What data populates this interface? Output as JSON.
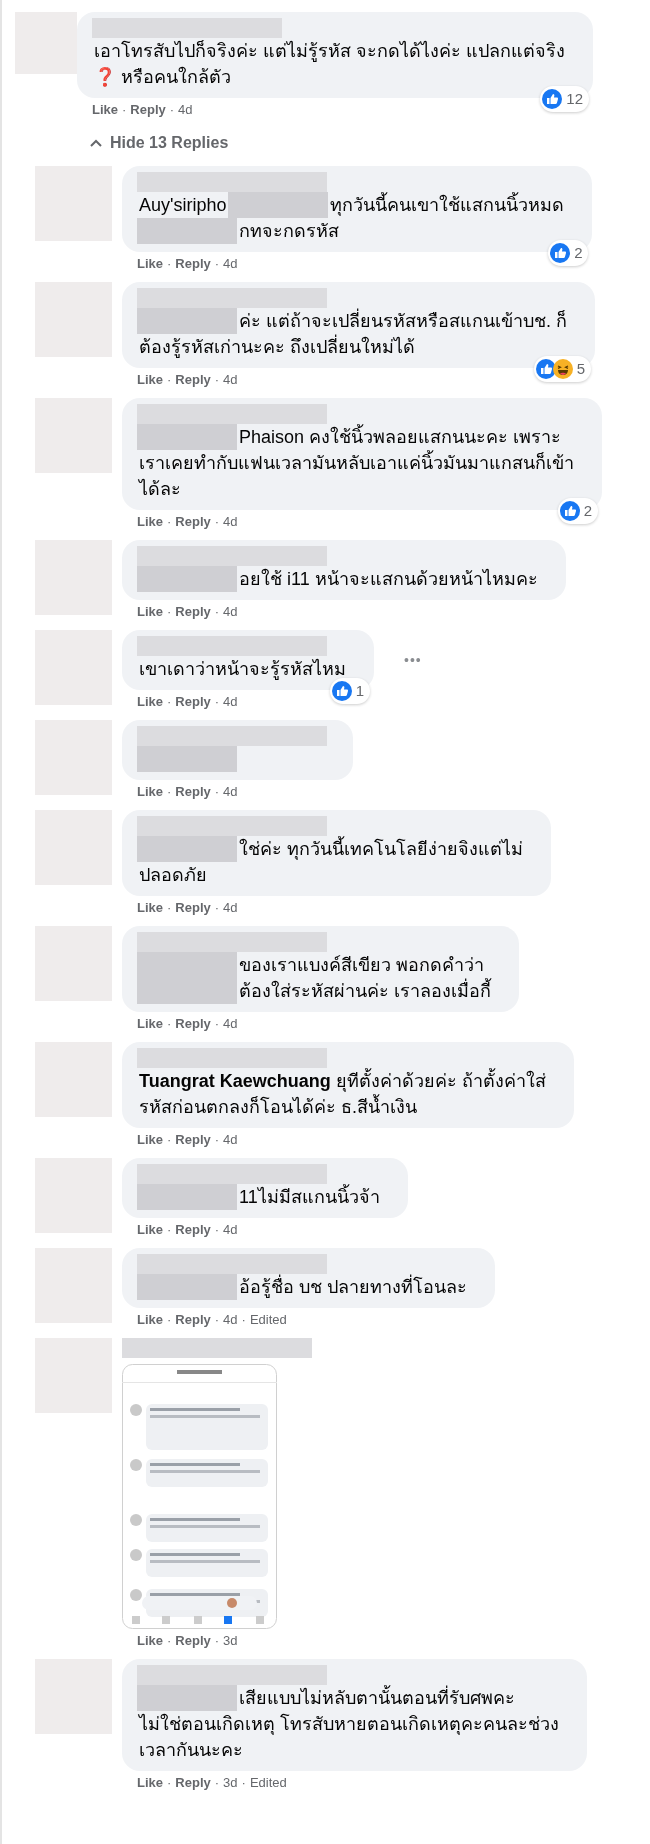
{
  "separator": "·",
  "comments": [
    {
      "kind": "comment",
      "lines": [
        [
          {
            "kind": "mask"
          }
        ],
        [
          {
            "kind": "text",
            "text": "เอาโทรสับไปก็จริงค่ะ แต่ไม่รู้รหัส จะกดได้ไงค่ะ แปลกแต่จริง"
          }
        ],
        [
          {
            "kind": "text",
            "text": "❓ หรือคนใกล้ตัว"
          }
        ]
      ],
      "reactions": {
        "icons": [
          {
            "kind": "like"
          }
        ],
        "count": "12"
      },
      "meta": [
        {
          "kind": "link",
          "text": "Like"
        },
        {
          "kind": "link",
          "text": "Reply"
        },
        {
          "kind": "time",
          "text": "4d"
        }
      ]
    },
    {
      "kind": "toggle",
      "text": "Hide 13 Replies"
    },
    {
      "kind": "reply",
      "lines": [
        [
          {
            "kind": "mask"
          }
        ],
        [
          {
            "kind": "text",
            "text": "Auy'siripho"
          },
          {
            "kind": "mask"
          },
          {
            "kind": "text",
            "text": "ทุกวันนี้คนเขาใช้แสกนนิ้วหมด"
          }
        ],
        [
          {
            "kind": "mask"
          },
          {
            "kind": "text",
            "text": "กทจะกดรหัส"
          }
        ]
      ],
      "reactions": {
        "icons": [
          {
            "kind": "like"
          }
        ],
        "count": "2"
      },
      "meta": [
        {
          "kind": "link",
          "text": "Like"
        },
        {
          "kind": "link",
          "text": "Reply"
        },
        {
          "kind": "time",
          "text": "4d"
        }
      ]
    },
    {
      "kind": "reply",
      "lines": [
        [
          {
            "kind": "mask"
          }
        ],
        [
          {
            "kind": "mask"
          },
          {
            "kind": "text",
            "text": "ค่ะ แต่ถ้าจะเปลี่ยนรหัสหรือสแกนเข้าบช. ก็"
          }
        ],
        [
          {
            "kind": "text",
            "text": "ต้องรู้รหัสเก่านะคะ ถึงเปลี่ยนใหม่ได้"
          }
        ]
      ],
      "reactions": {
        "icons": [
          {
            "kind": "like"
          },
          {
            "kind": "haha"
          }
        ],
        "count": "5"
      },
      "meta": [
        {
          "kind": "link",
          "text": "Like"
        },
        {
          "kind": "link",
          "text": "Reply"
        },
        {
          "kind": "time",
          "text": "4d"
        }
      ]
    },
    {
      "kind": "reply",
      "lines": [
        [
          {
            "kind": "mask"
          }
        ],
        [
          {
            "kind": "mask"
          },
          {
            "kind": "text",
            "text": "Phaison คงใช้นิ้วพลอยแสกนนะคะ เพราะ"
          }
        ],
        [
          {
            "kind": "text",
            "text": "เราเคยทำกับแฟนเวลามันหลับเอาแค่นิ้วมันมาแกสนก็เข้า"
          }
        ],
        [
          {
            "kind": "text",
            "text": "ได้ละ"
          }
        ]
      ],
      "reactions": {
        "icons": [
          {
            "kind": "like"
          }
        ],
        "count": "2"
      },
      "meta": [
        {
          "kind": "link",
          "text": "Like"
        },
        {
          "kind": "link",
          "text": "Reply"
        },
        {
          "kind": "time",
          "text": "4d"
        }
      ]
    },
    {
      "kind": "reply",
      "lines": [
        [
          {
            "kind": "mask"
          }
        ],
        [
          {
            "kind": "mask"
          },
          {
            "kind": "text",
            "text": "อยใช้ i11 หน้าจะแสกนด้วยหน้าไหมคะ"
          }
        ]
      ],
      "meta": [
        {
          "kind": "link",
          "text": "Like"
        },
        {
          "kind": "link",
          "text": "Reply"
        },
        {
          "kind": "time",
          "text": "4d"
        }
      ]
    },
    {
      "kind": "reply",
      "lines": [
        [
          {
            "kind": "mask"
          }
        ],
        [
          {
            "kind": "text",
            "text": "เขาเดาว่าหน้าจะรู้รหัสไหม"
          }
        ]
      ],
      "reactions": {
        "icons": [
          {
            "kind": "like"
          }
        ],
        "count": "1"
      },
      "more": "•••",
      "meta": [
        {
          "kind": "link",
          "text": "Like"
        },
        {
          "kind": "link",
          "text": "Reply"
        },
        {
          "kind": "time",
          "text": "4d"
        }
      ]
    },
    {
      "kind": "reply",
      "lines": [
        [
          {
            "kind": "mask"
          }
        ],
        [
          {
            "kind": "mask"
          }
        ]
      ],
      "meta": [
        {
          "kind": "link",
          "text": "Like"
        },
        {
          "kind": "link",
          "text": "Reply"
        },
        {
          "kind": "time",
          "text": "4d"
        }
      ]
    },
    {
      "kind": "reply",
      "lines": [
        [
          {
            "kind": "mask"
          }
        ],
        [
          {
            "kind": "mask"
          },
          {
            "kind": "text",
            "text": "ใช่ค่ะ ทุกวันนี้เทคโนโลยีง่ายจิงแต่ไม่"
          }
        ],
        [
          {
            "kind": "text",
            "text": "ปลอดภัย"
          }
        ]
      ],
      "meta": [
        {
          "kind": "link",
          "text": "Like"
        },
        {
          "kind": "link",
          "text": "Reply"
        },
        {
          "kind": "time",
          "text": "4d"
        }
      ]
    },
    {
      "kind": "reply",
      "lines": [
        [
          {
            "kind": "mask"
          }
        ],
        [
          {
            "kind": "mask"
          },
          {
            "kind": "text",
            "text": "ของเราแบงค์สีเขียว พอกดคำว่า"
          }
        ],
        [
          {
            "kind": "mask"
          },
          {
            "kind": "text",
            "text": "ต้องใส่ระหัสผ่านค่ะ เราลองเมื่อกี้"
          }
        ]
      ],
      "meta": [
        {
          "kind": "link",
          "text": "Like"
        },
        {
          "kind": "link",
          "text": "Reply"
        },
        {
          "kind": "time",
          "text": "4d"
        }
      ]
    },
    {
      "kind": "reply",
      "lines": [
        [
          {
            "kind": "mask"
          }
        ],
        [
          {
            "kind": "text",
            "text": "**Tuangrat Kaewchuang** ยุทีตั้งค่าด้วยค่ะ ถ้าตั้งค่าใส่"
          }
        ],
        [
          {
            "kind": "text",
            "text": "รหัสก่อนตกลงก็โอนได้ค่ะ ธ.สีน้ำเงิน"
          }
        ]
      ],
      "meta": [
        {
          "kind": "link",
          "text": "Like"
        },
        {
          "kind": "link",
          "text": "Reply"
        },
        {
          "kind": "time",
          "text": "4d"
        }
      ]
    },
    {
      "kind": "reply",
      "lines": [
        [
          {
            "kind": "mask"
          }
        ],
        [
          {
            "kind": "mask"
          },
          {
            "kind": "text",
            "text": "11ไม่มีสแกนนิ้วจ้า"
          }
        ]
      ],
      "meta": [
        {
          "kind": "link",
          "text": "Like"
        },
        {
          "kind": "link",
          "text": "Reply"
        },
        {
          "kind": "time",
          "text": "4d"
        }
      ]
    },
    {
      "kind": "reply",
      "lines": [
        [
          {
            "kind": "mask"
          }
        ],
        [
          {
            "kind": "mask"
          },
          {
            "kind": "text",
            "text": "อ้อรู้ชื่อ บช ปลายทางที่โอนละ"
          }
        ]
      ],
      "meta": [
        {
          "kind": "link",
          "text": "Like"
        },
        {
          "kind": "link",
          "text": "Reply"
        },
        {
          "kind": "time",
          "text": "4d"
        },
        {
          "kind": "time",
          "text": "Edited"
        }
      ]
    },
    {
      "kind": "reply",
      "lines": [
        [
          {
            "kind": "mask"
          }
        ]
      ],
      "attachment": {
        "kind": "screenshot"
      },
      "meta": [
        {
          "kind": "link",
          "text": "Like"
        },
        {
          "kind": "link",
          "text": "Reply"
        },
        {
          "kind": "time",
          "text": "3d"
        }
      ]
    },
    {
      "kind": "reply",
      "lines": [
        [
          {
            "kind": "mask"
          }
        ],
        [
          {
            "kind": "mask"
          },
          {
            "kind": "text",
            "text": "เสียแบบไม่หลับตานั้นตอนที่รับศพคะ"
          }
        ],
        [
          {
            "kind": "text",
            "text": "ไม่ใช่ตอนเกิดเหตุ โทรสับหายตอนเกิดเหตุคะคนละช่วง"
          }
        ],
        [
          {
            "kind": "text",
            "text": "เวลากันนะคะ"
          }
        ]
      ],
      "meta": [
        {
          "kind": "link",
          "text": "Like"
        },
        {
          "kind": "link",
          "text": "Reply"
        },
        {
          "kind": "time",
          "text": "3d"
        },
        {
          "kind": "time",
          "text": "Edited"
        }
      ]
    }
  ]
}
